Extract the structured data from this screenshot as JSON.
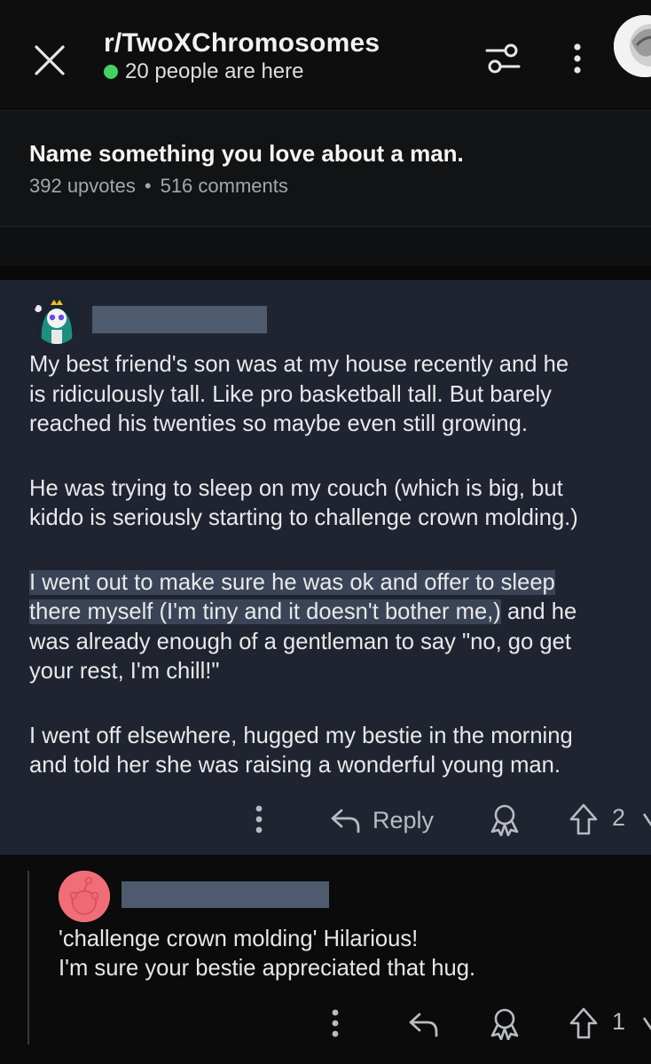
{
  "header": {
    "subreddit": "r/TwoXChromosomes",
    "online_text": "20 people are here",
    "online_color": "#46d160",
    "close_icon": "close-icon",
    "filter_icon": "sort-filter-icon",
    "more_icon": "more-vertical-icon"
  },
  "post": {
    "title": "Name something you love about a man.",
    "upvotes": "392 upvotes",
    "separator": "•",
    "comments": "516 comments"
  },
  "comment1": {
    "username_redacted": true,
    "paragraphs": [
      [
        "My best friend's son was at my house recently and he",
        "is ridiculously tall. Like pro basketball tall. But barely",
        "reached his twenties so maybe even still growing."
      ],
      [
        "He was trying to sleep on my couch (which is big, but",
        "kiddo is seriously starting to challenge crown molding.)"
      ]
    ],
    "p3_hl_line1": "I went out to make sure he was ok and offer to sleep",
    "p3_hl_line2": "there myself (I'm tiny and it doesn't bother me,)",
    "p3_rest_line2": " and he",
    "p3_line3": "was already enough of a gentleman to say \"no, go get",
    "p3_line4": "your rest, I'm chill!\"",
    "p4_line1": "I went off elsewhere, hugged my bestie in the morning",
    "p4_line2": "and told her she was raising a wonderful young man.",
    "reply_label": "Reply",
    "score": "2",
    "highlight_bg": "#1f2430"
  },
  "comment2": {
    "username_redacted": true,
    "line1": "'challenge crown molding' Hilarious!",
    "line2": "I'm sure your bestie appreciated that hug.",
    "score": "1",
    "avatar_color": "#f06e78"
  }
}
